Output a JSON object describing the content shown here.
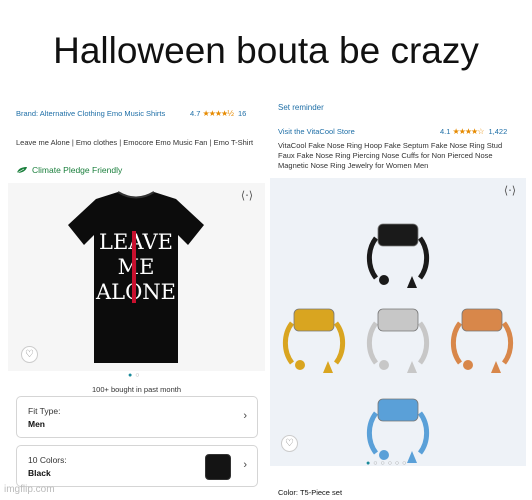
{
  "meme": {
    "caption": "Halloween bouta be crazy",
    "watermark": "imgflip.com"
  },
  "left_product": {
    "brand": "Brand: Alternative Clothing Emo Music Shirts",
    "rating": "4.7",
    "stars": "★★★★½",
    "review_count": "16",
    "title": "Leave me Alone | Emo clothes | Emocore Emo Music Fan | Emo T-Shirt",
    "climate_badge": "Climate Pledge Friendly",
    "shirt_text": [
      "LEAVE",
      "ME",
      "ALONE"
    ],
    "bought": "100+ bought in past month",
    "fit_type": {
      "label": "Fit Type:",
      "value": "Men"
    },
    "colors": {
      "label": "10 Colors:",
      "value": "Black",
      "swatch": "#141414"
    }
  },
  "right_product": {
    "set_reminder": "Set reminder",
    "store": "Visit the VitaCool Store",
    "rating": "4.1",
    "stars": "★★★★☆",
    "review_count": "1,422",
    "title": "VitaCool Fake Nose Ring Hoop Fake Septum Fake Nose Ring Stud Faux Fake Nose Ring Piercing Nose Cuffs for Non Pierced Nose Magnetic Nose Ring Jewelry for Women Men",
    "color_label": "Color: T5-Piece set",
    "ring_colors": [
      "#1a1a1a",
      "#d9a520",
      "#c7c7c7",
      "#d8874a",
      "#5aa0d8"
    ]
  }
}
